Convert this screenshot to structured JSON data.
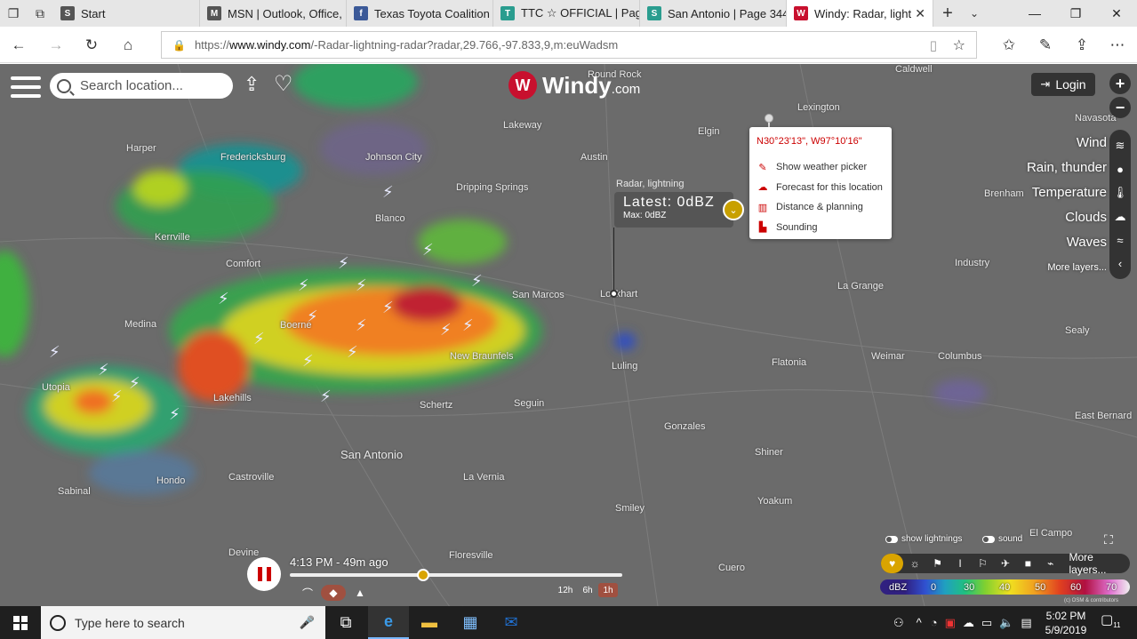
{
  "browser": {
    "tabs": [
      {
        "title": "Start",
        "favicon": "start-icon",
        "color": "#555555",
        "glyph": "S"
      },
      {
        "title": "MSN | Outlook, Office,",
        "favicon": "msn-icon",
        "color": "#555555",
        "glyph": "M"
      },
      {
        "title": "Texas Toyota Coalition (",
        "favicon": "facebook-icon",
        "color": "#3b5998",
        "glyph": "f"
      },
      {
        "title": "TTC ☆ OFFICIAL | Page",
        "favicon": "page-icon",
        "color": "#2a9d8f",
        "glyph": "T"
      },
      {
        "title": "San Antonio | Page 344",
        "favicon": "page-icon",
        "color": "#2a9d8f",
        "glyph": "S"
      },
      {
        "title": "Windy: Radar, light",
        "favicon": "windy-icon",
        "color": "#c8102e",
        "glyph": "W",
        "active": true
      }
    ],
    "url_prefix": "https://",
    "url_host": "www.windy.com",
    "url_path": "/-Radar-lightning-radar?radar,29.766,-97.833,9,m:euWadsm"
  },
  "windy": {
    "search_placeholder": "Search location...",
    "logo_text": "Windy",
    "logo_suffix": "com",
    "login_label": "Login",
    "layers": [
      "Wind",
      "Rain, thunder",
      "Temperature",
      "Clouds",
      "Waves"
    ],
    "more_layers": "More layers...",
    "radar_label": "Radar, lightning",
    "latest": "Latest: 0dBZ",
    "max": "Max: 0dBZ",
    "popup": {
      "coord": "N30°23'13\", W97°10'16\"",
      "items": [
        "Show weather picker",
        "Forecast for this location",
        "Distance & planning",
        "Sounding"
      ]
    },
    "timeline": {
      "label": "4:13 PM - 49m ago",
      "progress_fraction": 0.4,
      "ranges": [
        "12h",
        "6h",
        "1h"
      ],
      "selected_range": "1h"
    },
    "toggles": [
      "show lightnings",
      "sound"
    ],
    "overlay_more": "More layers...",
    "legend_unit": "dBZ",
    "legend_values": [
      "0",
      "30",
      "40",
      "50",
      "60",
      "70"
    ],
    "credit": "(c) OSM & contributors",
    "accent": "#d9a400"
  },
  "cities": [
    {
      "name": "Round Rock"
    },
    {
      "name": "Caldwell"
    },
    {
      "name": "Lexington"
    },
    {
      "name": "Navasota"
    },
    {
      "name": "Lakeway"
    },
    {
      "name": "Elgin"
    },
    {
      "name": "Harper"
    },
    {
      "name": "Fredericksburg"
    },
    {
      "name": "Johnson City"
    },
    {
      "name": "Austin"
    },
    {
      "name": "Dripping Springs"
    },
    {
      "name": "Brenham"
    },
    {
      "name": "Blanco"
    },
    {
      "name": "Kerrville"
    },
    {
      "name": "Comfort"
    },
    {
      "name": "Industry"
    },
    {
      "name": "San Marcos"
    },
    {
      "name": "Lockhart"
    },
    {
      "name": "La Grange"
    },
    {
      "name": "Medina"
    },
    {
      "name": "Boerne"
    },
    {
      "name": "Sealy"
    },
    {
      "name": "New Braunfels"
    },
    {
      "name": "Luling"
    },
    {
      "name": "Flatonia"
    },
    {
      "name": "Weimar"
    },
    {
      "name": "Columbus"
    },
    {
      "name": "Utopia"
    },
    {
      "name": "Lakehills"
    },
    {
      "name": "Schertz"
    },
    {
      "name": "Seguin"
    },
    {
      "name": "East Bernard"
    },
    {
      "name": "Gonzales"
    },
    {
      "name": "San Antonio"
    },
    {
      "name": "Shiner"
    },
    {
      "name": "Sabinal"
    },
    {
      "name": "Hondo"
    },
    {
      "name": "Castroville"
    },
    {
      "name": "La Vernia"
    },
    {
      "name": "Yoakum"
    },
    {
      "name": "Smiley"
    },
    {
      "name": "El Campo"
    },
    {
      "name": "Devine"
    },
    {
      "name": "Floresville"
    },
    {
      "name": "Cuero"
    }
  ],
  "taskbar": {
    "search_placeholder": "Type here to search",
    "time": "5:02 PM",
    "date": "5/9/2019",
    "notifications": "11"
  }
}
